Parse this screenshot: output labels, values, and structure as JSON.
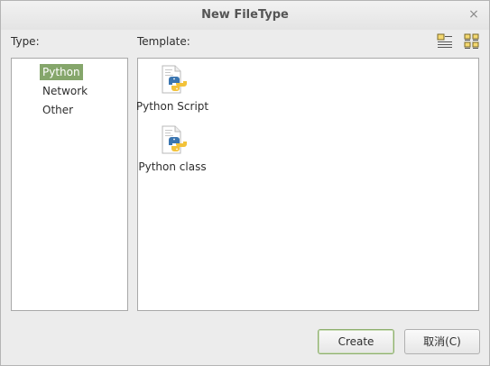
{
  "window": {
    "title": "New FileType",
    "close_glyph": "×"
  },
  "labels": {
    "type": "Type:",
    "template": "Template:"
  },
  "view_buttons": [
    {
      "icon": "icon-view-icon"
    },
    {
      "icon": "list-view-icon"
    }
  ],
  "types": [
    {
      "label": "Python",
      "selected": true
    },
    {
      "label": "Network",
      "selected": false
    },
    {
      "label": "Other",
      "selected": false
    }
  ],
  "templates": [
    {
      "label": "Python Script",
      "icon": "python-file-icon"
    },
    {
      "label": "Python class",
      "icon": "python-file-icon"
    }
  ],
  "buttons": {
    "create": "Create",
    "cancel": "取消(C)"
  },
  "colors": {
    "selection": "#85a66b",
    "python_blue": "#3a75b0",
    "python_yellow": "#f2c23a"
  }
}
